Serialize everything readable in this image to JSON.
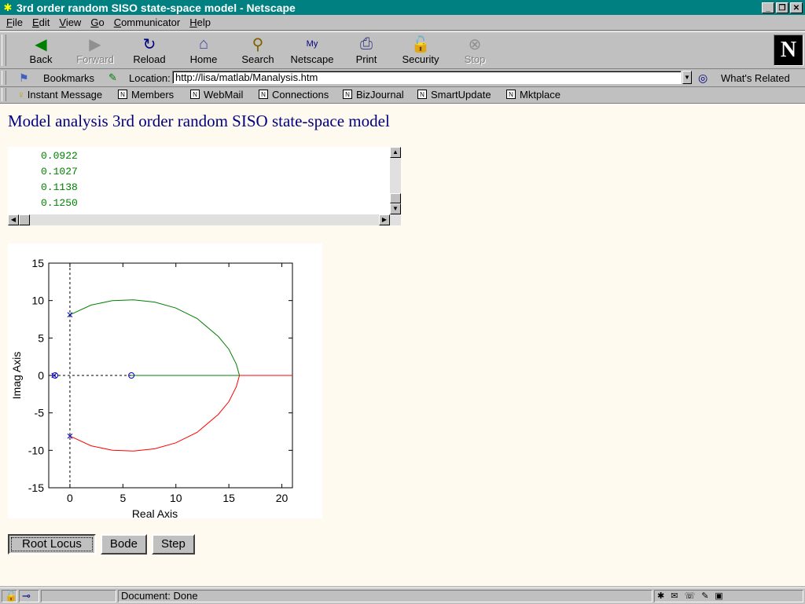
{
  "window": {
    "title": "3rd order random SISO state-space model - Netscape"
  },
  "menu": [
    "File",
    "Edit",
    "View",
    "Go",
    "Communicator",
    "Help"
  ],
  "toolbar": [
    {
      "label": "Back",
      "icon": "back-arrow-icon",
      "enabled": true
    },
    {
      "label": "Forward",
      "icon": "forward-arrow-icon",
      "enabled": false
    },
    {
      "label": "Reload",
      "icon": "reload-icon",
      "enabled": true
    },
    {
      "label": "Home",
      "icon": "home-icon",
      "enabled": true
    },
    {
      "label": "Search",
      "icon": "search-icon",
      "enabled": true
    },
    {
      "label": "Netscape",
      "icon": "netscape-icon",
      "enabled": true
    },
    {
      "label": "Print",
      "icon": "print-icon",
      "enabled": true
    },
    {
      "label": "Security",
      "icon": "lock-icon",
      "enabled": true
    },
    {
      "label": "Stop",
      "icon": "stop-icon",
      "enabled": false
    }
  ],
  "location": {
    "bookmarks_label": "Bookmarks",
    "label": "Location:",
    "url": "http://lisa/matlab/Manalysis.htm",
    "related": "What's Related"
  },
  "personal_toolbar": [
    "Instant Message",
    "Members",
    "WebMail",
    "Connections",
    "BizJournal",
    "SmartUpdate",
    "Mktplace"
  ],
  "page": {
    "heading": "Model analysis 3rd order random SISO state-space model",
    "values": [
      "0.0922",
      "0.1027",
      "0.1138",
      "0.1250"
    ],
    "buttons": [
      "Root Locus",
      "Bode",
      "Step"
    ]
  },
  "chart_data": {
    "type": "line",
    "title": "",
    "xlabel": "Real Axis",
    "ylabel": "Imag Axis",
    "xlim": [
      -2,
      21
    ],
    "ylim": [
      -15,
      15
    ],
    "xticks": [
      0,
      5,
      10,
      15,
      20
    ],
    "yticks": [
      -15,
      -10,
      -5,
      0,
      5,
      10,
      15
    ],
    "poles": [
      {
        "x": 0,
        "y": 8.1
      },
      {
        "x": 0,
        "y": -8.1
      },
      {
        "x": -1.5,
        "y": 0
      }
    ],
    "zeros": [
      {
        "x": 5.8,
        "y": 0
      },
      {
        "x": -1.4,
        "y": 0
      }
    ],
    "series": [
      {
        "color": "#008000",
        "x": [
          0,
          2,
          4,
          6,
          8,
          10,
          12,
          14,
          15,
          15.7,
          16
        ],
        "y": [
          8.1,
          9.4,
          10,
          10.1,
          9.8,
          9,
          7.6,
          5.2,
          3.5,
          1.5,
          0
        ]
      },
      {
        "color": "#ff0000",
        "x": [
          0,
          2,
          4,
          6,
          8,
          10,
          12,
          14,
          15,
          15.7,
          16
        ],
        "y": [
          -8.1,
          -9.4,
          -10,
          -10.1,
          -9.8,
          -9,
          -7.6,
          -5.2,
          -3.5,
          -1.5,
          0
        ]
      },
      {
        "color": "#008000",
        "x": [
          5.8,
          16
        ],
        "y": [
          0,
          0
        ]
      },
      {
        "color": "#ff0000",
        "x": [
          16,
          21
        ],
        "y": [
          0,
          0
        ]
      }
    ]
  },
  "status": {
    "text": "Document: Done"
  }
}
